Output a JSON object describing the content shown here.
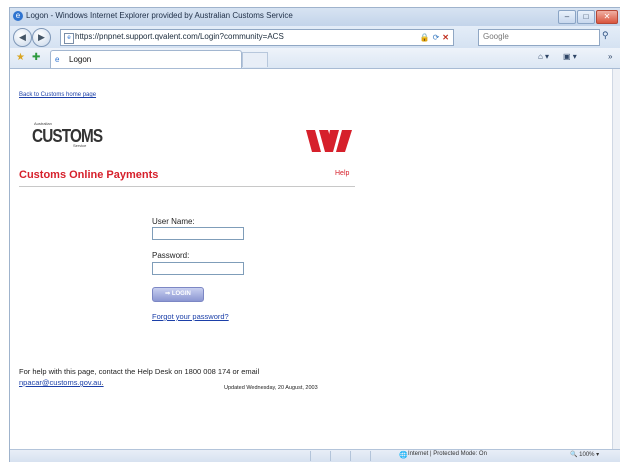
{
  "window": {
    "title": "Logon - Windows Internet Explorer provided by Australian Customs Service",
    "controls": {
      "minimize": "–",
      "maximize": "□",
      "close": "✕"
    }
  },
  "addressbar": {
    "url": "https://pnpnet.support.qvalent.com/Login?community=ACS",
    "search_placeholder": "Google"
  },
  "tabbar": {
    "tab_label": "Logon",
    "commands": {
      "home": "⌂ ▾",
      "tools": "▣ ▾",
      "more": "»"
    }
  },
  "page": {
    "back_link": "Back to Customs home page",
    "logo": {
      "top": "Australian",
      "main": "CUSTOMS",
      "bottom": "Service"
    },
    "heading": "Customs Online Payments",
    "help_link": "Help",
    "form": {
      "username_label": "User Name:",
      "username_value": "",
      "password_label": "Password:",
      "password_value": "",
      "login_label": "LOGIN",
      "forgot_link": "Forgot your password?"
    },
    "footer": {
      "help_text": "For help with this page, contact the Help Desk on 1800 008 174 or email",
      "email": "npacar@customs.gov.au",
      "email_suffix": ".",
      "updated": "Updated Wednesday, 20 August, 2003"
    }
  },
  "statusbar": {
    "zone": "Internet | Protected Mode: On",
    "zoom": "100%"
  },
  "colors": {
    "brand_red": "#d6202b",
    "link_blue": "#1b3fa8"
  }
}
